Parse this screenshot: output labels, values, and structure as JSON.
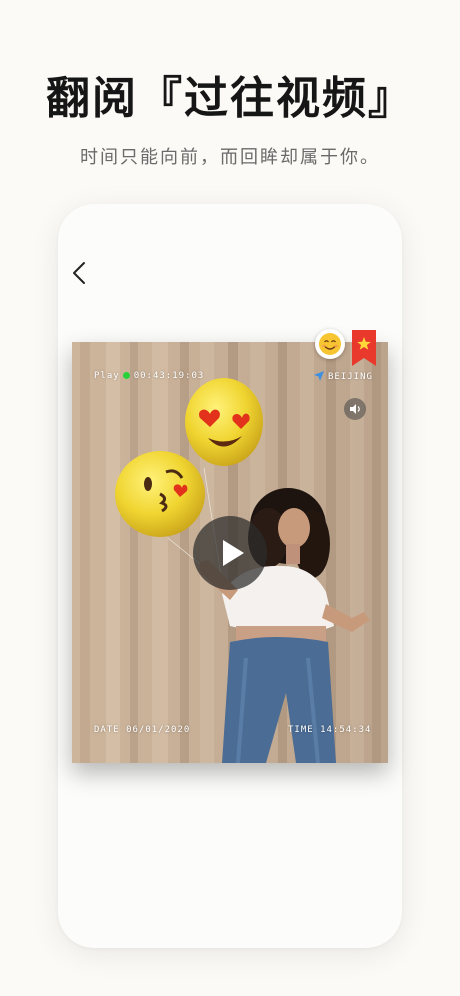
{
  "headline": "翻阅『过往视频』",
  "subline": "时间只能向前，而回眸却属于你。",
  "video": {
    "play_label": "Play",
    "play_time": "00:43:19:03",
    "location": "BEIJING",
    "date": "DATE 06/01/2020",
    "time": "TIME 14:54:34"
  },
  "icons": {
    "back": "chevron-left-icon",
    "mute": "speaker-icon",
    "play": "play-icon",
    "location": "location-arrow-icon",
    "emoji": "smiley-icon",
    "bookmark": "star-bookmark-icon"
  },
  "colors": {
    "background": "#fbfaf6",
    "headline": "#161616",
    "rec_dot": "#27d13a",
    "bookmark": "#e8392c",
    "location_arrow": "#3f8fe0"
  }
}
